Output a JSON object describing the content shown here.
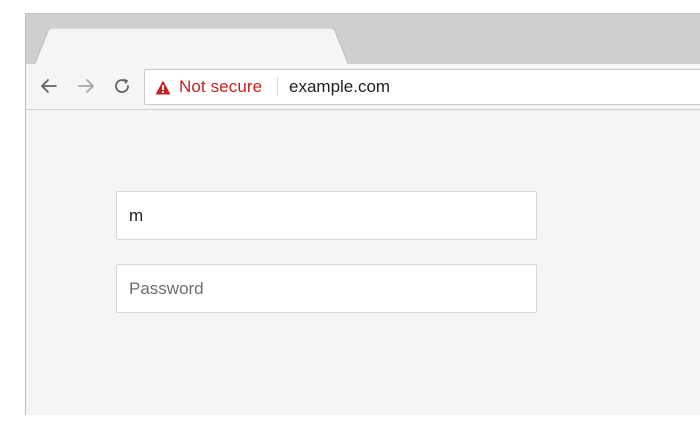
{
  "browser": {
    "toolbar": {
      "back_icon": "arrow-left-icon",
      "forward_icon": "arrow-right-icon",
      "reload_icon": "reload-icon"
    },
    "omnibox": {
      "security_icon": "warning-triangle-icon",
      "security_label": "Not secure",
      "security_color": "#c5221f",
      "url": "example.com"
    }
  },
  "form": {
    "username": {
      "value": "m",
      "placeholder": ""
    },
    "password": {
      "value": "",
      "placeholder": "Password"
    }
  }
}
